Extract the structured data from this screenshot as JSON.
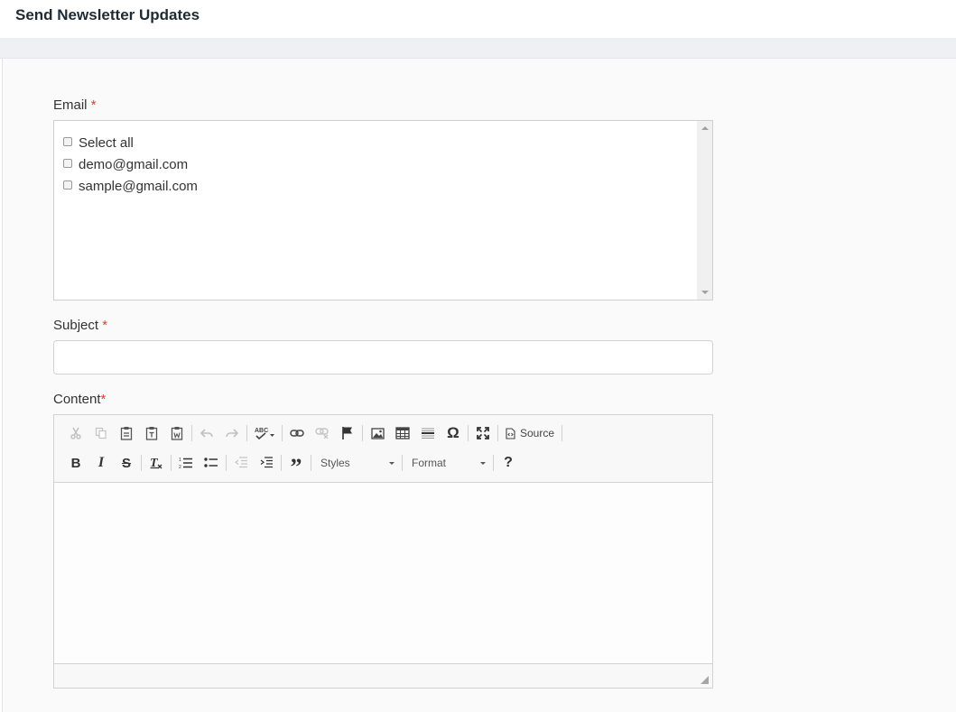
{
  "header": {
    "title": "Send Newsletter Updates"
  },
  "form": {
    "email": {
      "label": "Email",
      "required_mark": "*",
      "options": [
        {
          "label": "Select all",
          "checked": false
        },
        {
          "label": "demo@gmail.com",
          "checked": false
        },
        {
          "label": "sample@gmail.com",
          "checked": false
        }
      ]
    },
    "subject": {
      "label": "Subject",
      "required_mark": "*",
      "value": ""
    },
    "content": {
      "label": "Content",
      "required_mark": "*",
      "toolbar": {
        "source_label": "Source",
        "styles_label": "Styles",
        "format_label": "Format",
        "help_label": "?"
      }
    }
  },
  "colors": {
    "required": "#e53935",
    "page_strip": "#eef0f4"
  }
}
